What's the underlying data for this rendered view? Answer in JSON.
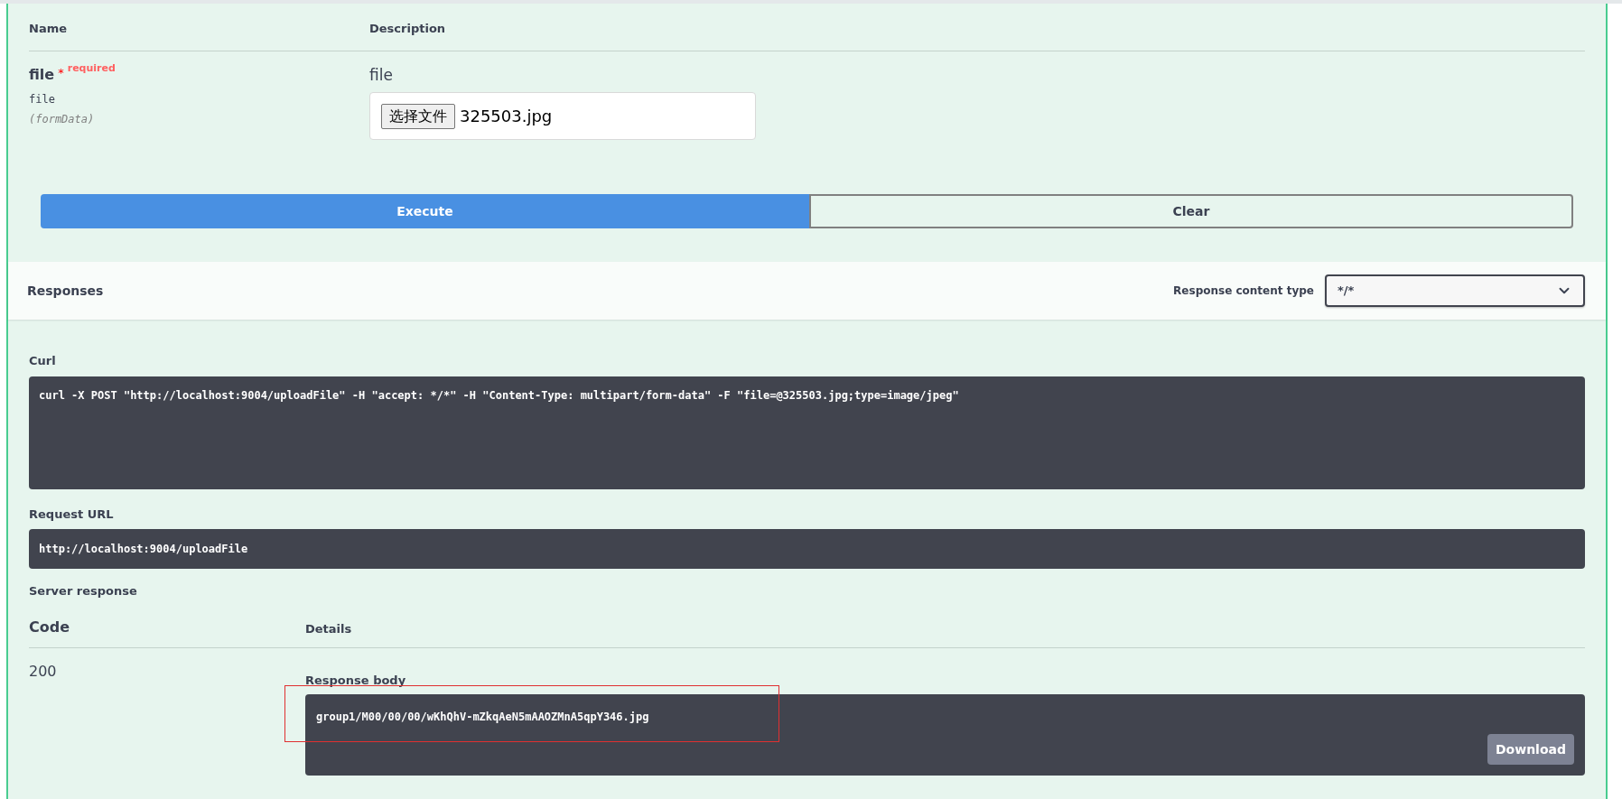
{
  "parameters": {
    "columns": [
      "Name",
      "Description"
    ],
    "items": [
      {
        "name": "file",
        "required_mark": "*",
        "required_label": "required",
        "type": "file",
        "location": "(formData)",
        "description": "file",
        "choose_button": "选择文件",
        "file_name": "325503.jpg"
      }
    ]
  },
  "actions": {
    "execute": "Execute",
    "clear": "Clear"
  },
  "responses": {
    "title": "Responses",
    "content_type_label": "Response content type",
    "content_type": "*/*"
  },
  "curl": {
    "label": "Curl",
    "command": "curl -X POST \"http://localhost:9004/uploadFile\" -H \"accept: */*\" -H \"Content-Type: multipart/form-data\" -F \"file=@325503.jpg;type=image/jpeg\""
  },
  "request_url": {
    "label": "Request URL",
    "value": "http://localhost:9004/uploadFile"
  },
  "server_response": {
    "title": "Server response",
    "columns": [
      "Code",
      "Details"
    ],
    "code": "200",
    "body_label": "Response body",
    "body": "group1/M00/00/00/wKhQhV-mZkqAeN5mAAOZMnA5qpY346.jpg",
    "highlighted": true,
    "download": "Download"
  }
}
